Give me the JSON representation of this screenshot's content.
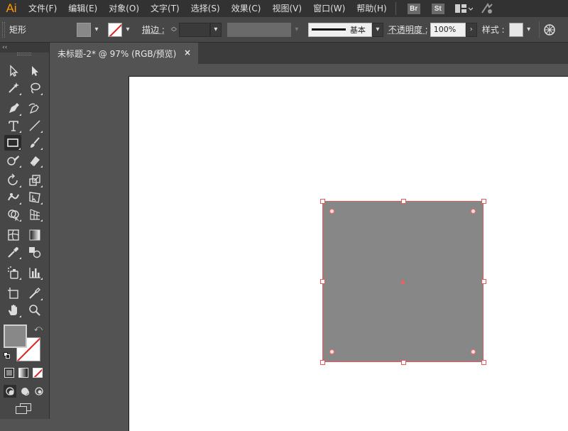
{
  "app": {
    "logo": "Ai"
  },
  "menu": {
    "items": [
      "文件(F)",
      "编辑(E)",
      "对象(O)",
      "文字(T)",
      "选择(S)",
      "效果(C)",
      "视图(V)",
      "窗口(W)",
      "帮助(H)"
    ],
    "bridge_badge": "Br",
    "stock_badge": "St"
  },
  "control": {
    "tool_name": "矩形",
    "stroke_label": "描边 :",
    "stroke_profile": "基本",
    "opacity_label": "不透明度 :",
    "opacity_value": "100%",
    "style_label": "样式 :",
    "fill_color": "#888888"
  },
  "document": {
    "tab_title": "未标题-2* @ 97% (RGB/预览)",
    "close": "×"
  },
  "shape": {
    "type": "rectangle",
    "fill": "#878787",
    "selection_color": "#e65a5a"
  },
  "toolbar": {
    "collapse": "‹‹",
    "tools": [
      "selection-tool",
      "direct-selection-tool",
      "magic-wand-tool",
      "lasso-tool",
      "pen-tool",
      "curvature-tool",
      "type-tool",
      "line-segment-tool",
      "rectangle-tool",
      "paintbrush-tool",
      "shaper-tool",
      "eraser-tool",
      "rotate-tool",
      "scale-tool",
      "warp-tool",
      "free-transform-tool",
      "shape-builder-tool",
      "perspective-grid-tool",
      "mesh-tool",
      "gradient-tool",
      "eyedropper-tool",
      "blend-tool",
      "symbol-sprayer-tool",
      "column-graph-tool",
      "artboard-tool",
      "slice-tool",
      "hand-tool",
      "zoom-tool"
    ],
    "fill_color": "#888888"
  }
}
